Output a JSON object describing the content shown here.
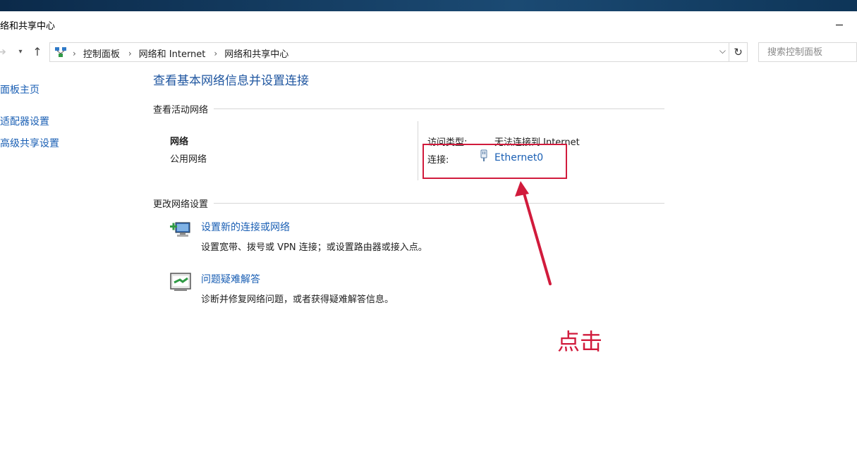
{
  "window": {
    "title": "络和共享中心"
  },
  "navigation": {
    "back_icon": "arrow-right-icon",
    "dropdown_icon": "chevron-down-icon",
    "up_icon": "arrow-up-icon",
    "breadcrumbs": [
      "控制面板",
      "网络和 Internet",
      "网络和共享中心"
    ],
    "search_placeholder": "搜索控制面板"
  },
  "sidebar": {
    "items": [
      "制面板主页",
      "改适配器设置",
      "改高级共享设置"
    ]
  },
  "main": {
    "title": "查看基本网络信息并设置连接",
    "active_networks_header": "查看活动网络",
    "network": {
      "name": "网络",
      "type": "公用网络",
      "access_type_label": "访问类型:",
      "access_type_value": "无法连接到 Internet",
      "connections_label": "连接:",
      "connection_name": "Ethernet0"
    },
    "change_settings_header": "更改网络设置",
    "tasks": [
      {
        "link": "设置新的连接或网络",
        "desc": "设置宽带、拨号或 VPN 连接；或设置路由器或接入点。",
        "icon": "new-connection-icon"
      },
      {
        "link": "问题疑难解答",
        "desc": "诊断并修复网络问题，或者获得疑难解答信息。",
        "icon": "troubleshoot-icon"
      }
    ]
  },
  "annotation": {
    "text": "点击",
    "color": "#d11b3c"
  },
  "colors": {
    "link": "#1a5fb4",
    "title": "#1f56a0"
  }
}
